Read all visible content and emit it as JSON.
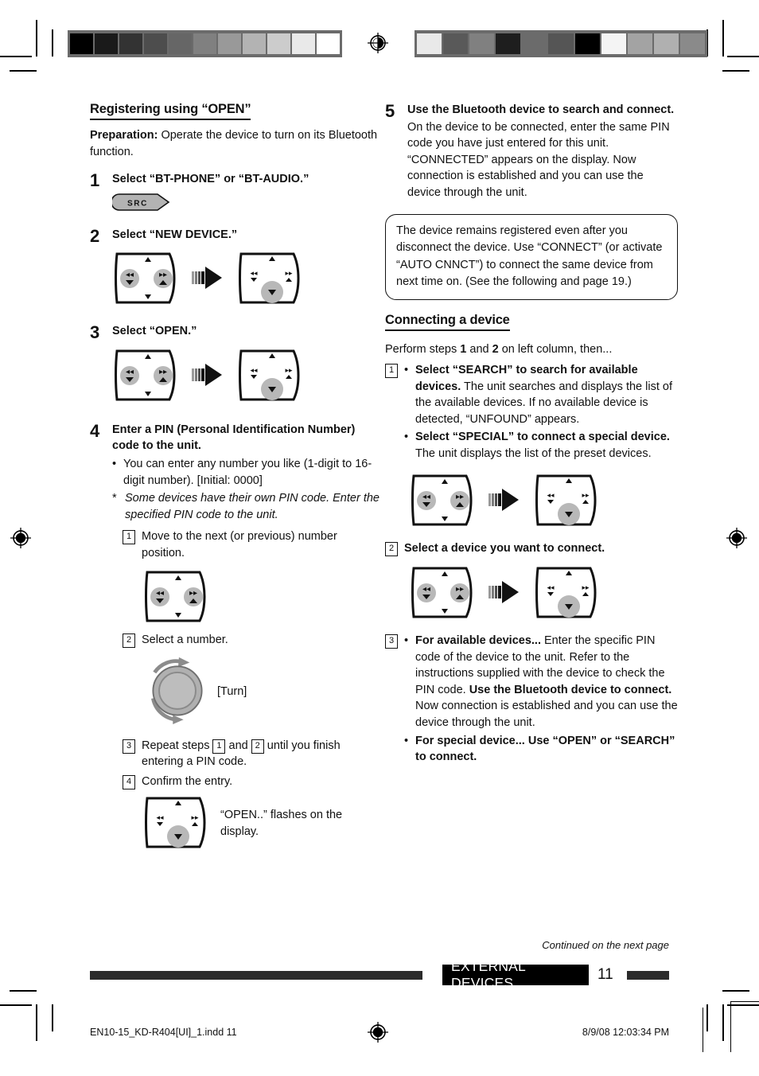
{
  "print_marks": {
    "gray_wedge_left": [
      "#000000",
      "#1a1a1a",
      "#333333",
      "#4d4d4d",
      "#666666",
      "#808080",
      "#999999",
      "#b3b3b3",
      "#cccccc",
      "#e9e9e9",
      "#ffffff"
    ],
    "gray_wedge_right": [
      "#e9e9e9",
      "#595959",
      "#808080",
      "#1e1e1e",
      "#6b6b6b",
      "#555555",
      "#000000",
      "#f4f4f4",
      "#a3a3a3",
      "#b0b0b0",
      "#8a8a8a"
    ],
    "registration_icon": "registration-target-icon"
  },
  "left_column": {
    "section_title": "Registering using “OPEN”",
    "preparation_label": "Preparation:",
    "preparation_text": " Operate the device to turn on its Bluetooth function.",
    "step1": {
      "num": "1",
      "heading": "Select “BT-PHONE” or “BT-AUDIO.”",
      "button_label": "SRC"
    },
    "step2": {
      "num": "2",
      "heading": "Select “NEW DEVICE.”"
    },
    "step3": {
      "num": "3",
      "heading": "Select “OPEN.”"
    },
    "step4": {
      "num": "4",
      "heading": "Enter a PIN (Personal Identification Number) code to the unit.",
      "bullet": "You can enter any number you like (1-digit to 16-digit number). [Initial: 0000]",
      "star_note": "Some devices have their own PIN code. Enter the specified PIN code to the unit.",
      "sub1_num": "1",
      "sub1_text": "Move to the next (or previous) number position.",
      "sub2_num": "2",
      "sub2_text": "Select a number.",
      "knob_label": "[Turn]",
      "sub3_num": "3",
      "sub3_text_a": "Repeat steps ",
      "sub3_ref_a": "1",
      "sub3_text_b": " and ",
      "sub3_ref_b": "2",
      "sub3_text_c": " until you finish entering a PIN code.",
      "sub4_num": "4",
      "sub4_text": "Confirm the entry.",
      "flash_note": "“OPEN..” flashes on the display."
    }
  },
  "right_column": {
    "step5": {
      "num": "5",
      "heading": "Use the Bluetooth device to search and connect.",
      "body": "On the device to be connected, enter the same PIN code you have just entered for this unit. “CONNECTED” appears on the display. Now connection is established and you can use the device through the unit."
    },
    "note_box": "The device remains registered even after you disconnect the device. Use “CONNECT” (or activate “AUTO CNNCT”) to connect the same device from next time on. (See the following and page 19.)",
    "section_title": "Connecting a device",
    "perform_a": "Perform steps ",
    "perform_num1": "1",
    "perform_b": " and ",
    "perform_num2": "2",
    "perform_c": " on left column, then...",
    "step1": {
      "num": "1",
      "bullet1_bold": "Select “SEARCH” to search for available devices.",
      "bullet1_body": "The unit searches and displays the list of the available devices. If no available device is detected, “UNFOUND” appears.",
      "bullet2_bold": "Select “SPECIAL” to connect a special device.",
      "bullet2_body": "The unit displays the list of the preset devices."
    },
    "step2": {
      "num": "2",
      "heading": "Select a device you want to connect."
    },
    "step3": {
      "num": "3",
      "bullet1_bold": "For available devices...",
      "bullet1_body1": "Enter the specific PIN code of the device to the unit.",
      "bullet1_body2": "Refer to the instructions supplied with the device to check the PIN code.",
      "bullet1_bold2": "Use the Bluetooth device to connect.",
      "bullet1_body3": "Now connection is established and you can use the device through the unit.",
      "bullet2_bold": "For special device...",
      "bullet2_bold2": "Use “OPEN” or “SEARCH” to connect."
    }
  },
  "footer": {
    "continued": "Continued on the next page",
    "section_label": "EXTERNAL DEVICES",
    "page_number": "11"
  },
  "print_footer": {
    "file": "EN10-15_KD-R404[UI]_1.indd   11",
    "timestamp": "8/9/08   12:03:34 PM"
  }
}
